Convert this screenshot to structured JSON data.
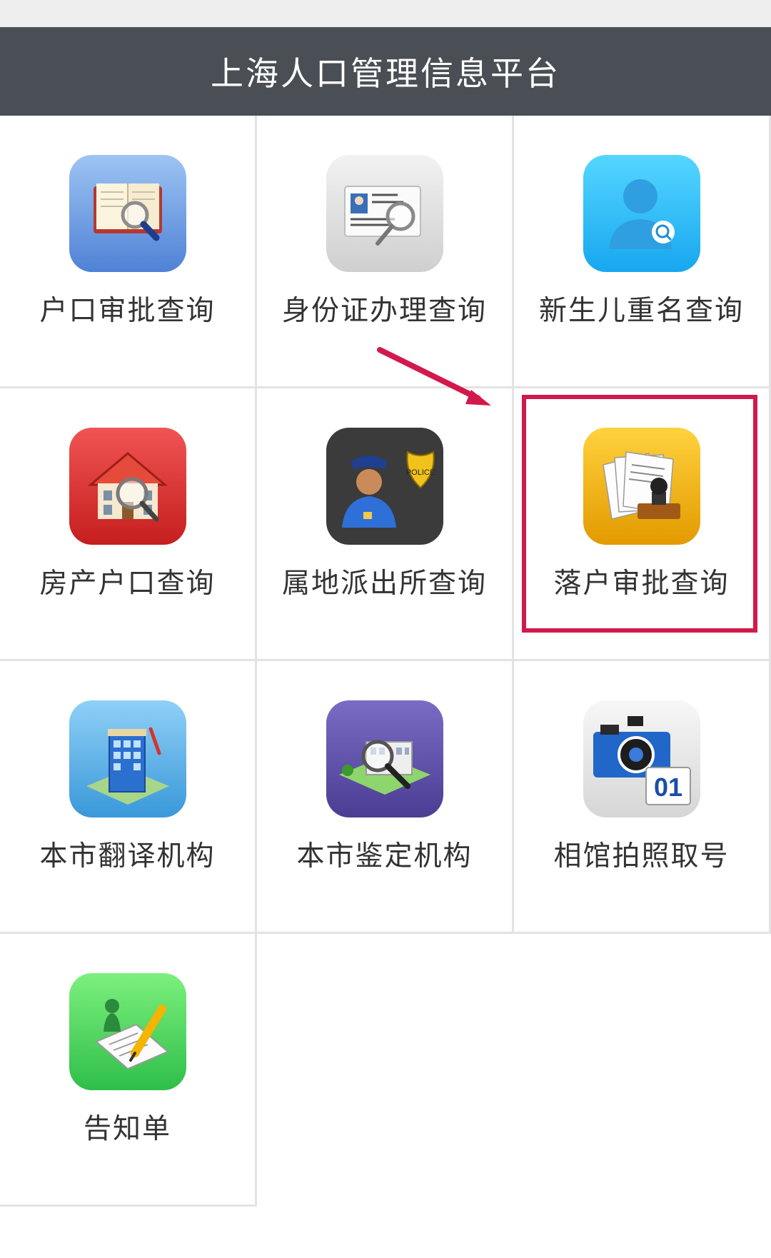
{
  "header": {
    "title": "上海人口管理信息平台"
  },
  "grid": {
    "items": [
      {
        "label": "户口审批查询",
        "icon": "book-search-icon"
      },
      {
        "label": "身份证办理查询",
        "icon": "id-card-search-icon"
      },
      {
        "label": "新生儿重名查询",
        "icon": "person-search-icon"
      },
      {
        "label": "房产户口查询",
        "icon": "house-search-icon"
      },
      {
        "label": "属地派出所查询",
        "icon": "police-officer-icon"
      },
      {
        "label": "落户审批查询",
        "icon": "documents-stamp-icon"
      },
      {
        "label": "本市翻译机构",
        "icon": "translation-building-icon"
      },
      {
        "label": "本市鉴定机构",
        "icon": "appraisal-institution-icon"
      },
      {
        "label": "相馆拍照取号",
        "icon": "camera-ticket-icon"
      },
      {
        "label": "告知单",
        "icon": "notice-form-icon"
      }
    ]
  },
  "annotation": {
    "highlight_color": "#d2194b"
  },
  "theme": {
    "header_bg": "#494f55",
    "divider": "#e3e3e3"
  }
}
